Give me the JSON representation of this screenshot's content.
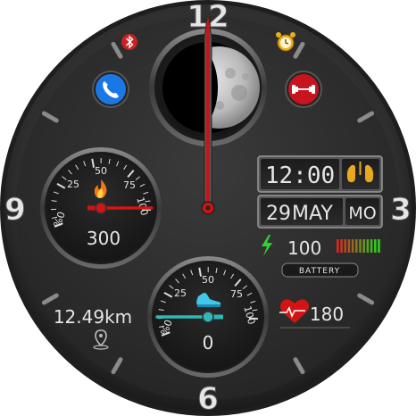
{
  "dial": {
    "hour_numerals": {
      "top": "12",
      "left": "9",
      "right": "3",
      "bottom": "6"
    }
  },
  "status_icons": {
    "bluetooth": "bluetooth-icon",
    "alarm": "alarm-clock-icon",
    "phone": "phone-icon",
    "fitness": "dumbbell-icon"
  },
  "moon_phase": {
    "icon": "moon-phase-icon",
    "illuminated_fraction": 0.6
  },
  "digital": {
    "time": "12:00",
    "day": "29",
    "month": "MAY",
    "weekday": "MO",
    "lungs_icon": "lungs-icon"
  },
  "calories_gauge": {
    "ticks": [
      "%0",
      "25",
      "50",
      "75",
      "100"
    ],
    "value_text": "300",
    "icon": "flame-icon",
    "needle_fraction": 1.0
  },
  "steps_gauge": {
    "ticks": [
      "%0",
      "25",
      "50",
      "75",
      "100"
    ],
    "value_text": "0",
    "icon": "shoe-icon",
    "needle_fraction": 0.0
  },
  "battery": {
    "value_text": "100",
    "label": "BATTERY",
    "icon": "lightning-icon",
    "level_fraction": 1.0
  },
  "distance": {
    "value_text": "12.49km",
    "icon": "location-pin-icon"
  },
  "heart_rate": {
    "value_text": "180",
    "icon": "heart-pulse-icon"
  },
  "hands": {
    "hour": 12,
    "minute": 0
  },
  "colors": {
    "bezel": "#3a3a3a",
    "face": "#2c2c2c",
    "accent_red": "#d41414",
    "accent_teal": "#2fb8b8",
    "phone_blue": "#1a78e6",
    "battery_green": "#22cc22"
  }
}
